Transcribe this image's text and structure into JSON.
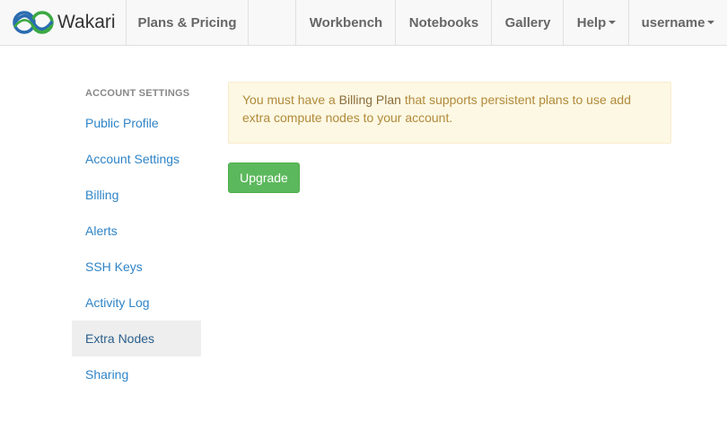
{
  "brand": {
    "name": "Wakari",
    "logo_icon": "wakari-logo-icon",
    "logo_colors": [
      "#2b6cb0",
      "#3aa843"
    ]
  },
  "nav": {
    "plans_pricing": "Plans & Pricing",
    "workbench": "Workbench",
    "notebooks": "Notebooks",
    "gallery": "Gallery",
    "help": "Help",
    "username": "username"
  },
  "sidebar": {
    "header": "ACCOUNT SETTINGS",
    "items": [
      {
        "label": "Public Profile"
      },
      {
        "label": "Account Settings"
      },
      {
        "label": "Billing"
      },
      {
        "label": "Alerts"
      },
      {
        "label": "SSH Keys"
      },
      {
        "label": "Activity Log"
      },
      {
        "label": "Extra Nodes",
        "active": true
      },
      {
        "label": "Sharing"
      }
    ]
  },
  "alert": {
    "prefix": "You must have a ",
    "link": "Billing Plan",
    "suffix": " that supports persistent plans to use add extra compute nodes to your account."
  },
  "upgrade_button": "Upgrade",
  "colors": {
    "link": "#2f84c7",
    "success": "#5cb85c",
    "warning_bg": "#fcf8e3",
    "warning_text": "#b28a3b"
  }
}
